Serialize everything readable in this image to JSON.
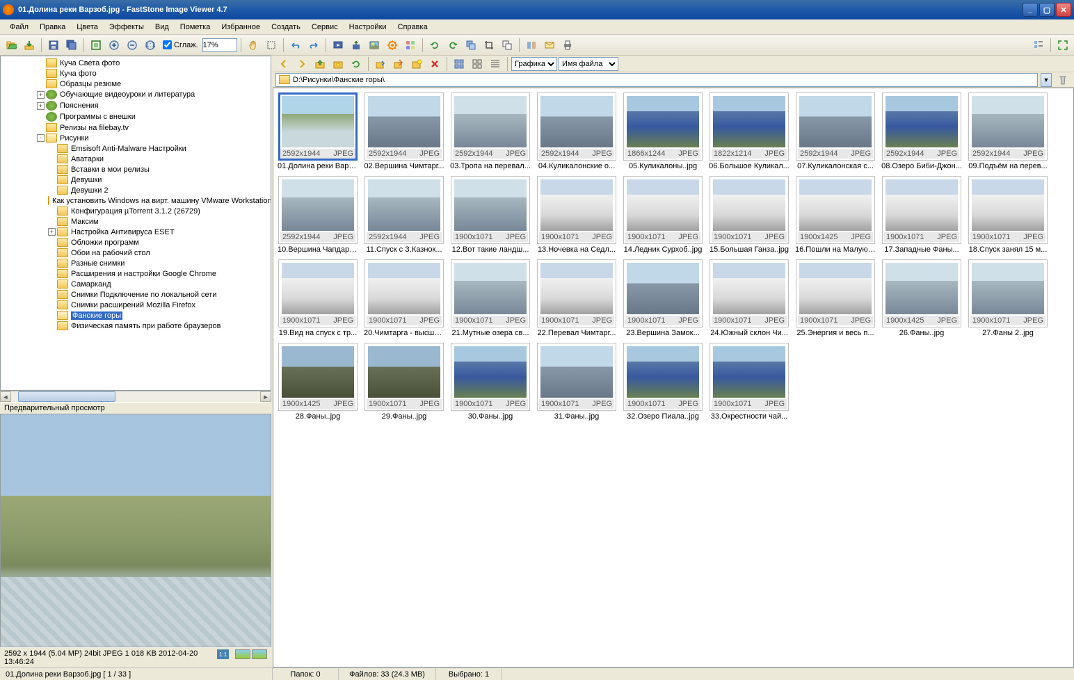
{
  "window": {
    "title": "01.Долина реки Варзоб.jpg  -  FastStone Image Viewer 4.7"
  },
  "menu": [
    "Файл",
    "Правка",
    "Цвета",
    "Эффекты",
    "Вид",
    "Пометка",
    "Избранное",
    "Создать",
    "Сервис",
    "Настройки",
    "Справка"
  ],
  "toolbar": {
    "smooth_label": "Сглаж.",
    "zoom": "17%"
  },
  "tree": [
    {
      "ind": 2,
      "exp": "",
      "ico": "fld",
      "label": "Куча Света фото"
    },
    {
      "ind": 2,
      "exp": "",
      "ico": "fld",
      "label": "Куча фото"
    },
    {
      "ind": 2,
      "exp": "",
      "ico": "fld",
      "label": "Образцы резюме"
    },
    {
      "ind": 2,
      "exp": "+",
      "ico": "gico",
      "label": "Обучающие видеоуроки и литература"
    },
    {
      "ind": 2,
      "exp": "+",
      "ico": "gico",
      "label": "Пояснения"
    },
    {
      "ind": 2,
      "exp": "",
      "ico": "gico",
      "label": "Программы с внешки"
    },
    {
      "ind": 2,
      "exp": "",
      "ico": "fld",
      "label": "Релизы на filebay.tv"
    },
    {
      "ind": 2,
      "exp": "-",
      "ico": "fld-open",
      "label": "Рисунки"
    },
    {
      "ind": 3,
      "exp": "",
      "ico": "fld",
      "label": "Emsisoft Anti-Malware Настройки"
    },
    {
      "ind": 3,
      "exp": "",
      "ico": "fld",
      "label": "Аватарки"
    },
    {
      "ind": 3,
      "exp": "",
      "ico": "fld",
      "label": "Вставки в мои релизы"
    },
    {
      "ind": 3,
      "exp": "",
      "ico": "fld",
      "label": "Девушки"
    },
    {
      "ind": 3,
      "exp": "",
      "ico": "fld",
      "label": "Девушки 2"
    },
    {
      "ind": 3,
      "exp": "",
      "ico": "fld",
      "label": "Как установить Windows на вирт. машину VMware Workstation"
    },
    {
      "ind": 3,
      "exp": "",
      "ico": "fld",
      "label": "Конфигурация  µTorrent 3.1.2 (26729)"
    },
    {
      "ind": 3,
      "exp": "",
      "ico": "fld",
      "label": "Максим"
    },
    {
      "ind": 3,
      "exp": "+",
      "ico": "fld",
      "label": "Настройка Антивируса ESET"
    },
    {
      "ind": 3,
      "exp": "",
      "ico": "fld",
      "label": "Обложки программ"
    },
    {
      "ind": 3,
      "exp": "",
      "ico": "fld",
      "label": "Обои на рабочий стол"
    },
    {
      "ind": 3,
      "exp": "",
      "ico": "fld",
      "label": "Разные снимки"
    },
    {
      "ind": 3,
      "exp": "",
      "ico": "fld",
      "label": "Расширения и настройки Google Chrome"
    },
    {
      "ind": 3,
      "exp": "",
      "ico": "fld",
      "label": "Самарканд"
    },
    {
      "ind": 3,
      "exp": "",
      "ico": "fld",
      "label": "Снимки Подключение по локальной сети"
    },
    {
      "ind": 3,
      "exp": "",
      "ico": "fld",
      "label": "Снимки расширений Mozilla Firefox"
    },
    {
      "ind": 3,
      "exp": "",
      "ico": "fld-open",
      "label": "Фанские горы",
      "sel": true
    },
    {
      "ind": 3,
      "exp": "",
      "ico": "fld",
      "label": "Физическая память при работе браузеров"
    }
  ],
  "preview": {
    "label": "Предварительный просмотр",
    "info": "2592 x 1944 (5.04 MP)  24bit  JPEG   1 018 KB   2012-04-20 13:46:24",
    "scale": "1:1"
  },
  "right": {
    "sort1": "Графика",
    "sort2": "Имя файла",
    "path": "D:\\Рисунки\\Фанские горы\\"
  },
  "thumbs": [
    {
      "name": "01.Долина реки Варз...",
      "dim": "2592x1944",
      "fmt": "JPEG",
      "bg": "bg-a",
      "sel": true
    },
    {
      "name": "02.Вершина Чимтарг...",
      "dim": "2592x1944",
      "fmt": "JPEG",
      "bg": "bg-b"
    },
    {
      "name": "03.Тропа на перевал...",
      "dim": "2592x1944",
      "fmt": "JPEG",
      "bg": "bg-d"
    },
    {
      "name": "04.Куликалонские о...",
      "dim": "2592x1944",
      "fmt": "JPEG",
      "bg": "bg-b"
    },
    {
      "name": "05.Куликалоны..jpg",
      "dim": "1866x1244",
      "fmt": "JPEG",
      "bg": "bg-c"
    },
    {
      "name": "06.Большое Куликал...",
      "dim": "1822x1214",
      "fmt": "JPEG",
      "bg": "bg-c"
    },
    {
      "name": "07.Куликалонская с...",
      "dim": "2592x1944",
      "fmt": "JPEG",
      "bg": "bg-b"
    },
    {
      "name": "08.Озеро Биби-Джон...",
      "dim": "2592x1944",
      "fmt": "JPEG",
      "bg": "bg-c"
    },
    {
      "name": "09.Подъём на перев...",
      "dim": "2592x1944",
      "fmt": "JPEG",
      "bg": "bg-d"
    },
    {
      "name": "10.Вершина Чапдара...",
      "dim": "2592x1944",
      "fmt": "JPEG",
      "bg": "bg-d"
    },
    {
      "name": "11.Спуск с З.Казнок...",
      "dim": "2592x1944",
      "fmt": "JPEG",
      "bg": "bg-d"
    },
    {
      "name": "12.Вот такие ландш...",
      "dim": "1900x1071",
      "fmt": "JPEG",
      "bg": "bg-d"
    },
    {
      "name": "13.Ночевка на Седл...",
      "dim": "1900x1071",
      "fmt": "JPEG",
      "bg": "bg-e"
    },
    {
      "name": "14.Ледник Сурхоб..jpg",
      "dim": "1900x1071",
      "fmt": "JPEG",
      "bg": "bg-e"
    },
    {
      "name": "15.Большая Ганза..jpg",
      "dim": "1900x1071",
      "fmt": "JPEG",
      "bg": "bg-e"
    },
    {
      "name": "16.Пошли на Малую ...",
      "dim": "1900x1425",
      "fmt": "JPEG",
      "bg": "bg-e"
    },
    {
      "name": "17.Западные Фаны...",
      "dim": "1900x1071",
      "fmt": "JPEG",
      "bg": "bg-e"
    },
    {
      "name": "18.Спуск занял 15 м...",
      "dim": "1900x1071",
      "fmt": "JPEG",
      "bg": "bg-e"
    },
    {
      "name": "19.Вид на спуск с тр...",
      "dim": "1900x1071",
      "fmt": "JPEG",
      "bg": "bg-e"
    },
    {
      "name": "20.Чимтарга - высша...",
      "dim": "1900x1071",
      "fmt": "JPEG",
      "bg": "bg-e"
    },
    {
      "name": "21.Мутные озера св...",
      "dim": "1900x1071",
      "fmt": "JPEG",
      "bg": "bg-d"
    },
    {
      "name": "22.Перевал Чимтарг...",
      "dim": "1900x1071",
      "fmt": "JPEG",
      "bg": "bg-e"
    },
    {
      "name": "23.Вершина Замок...",
      "dim": "1900x1071",
      "fmt": "JPEG",
      "bg": "bg-b"
    },
    {
      "name": "24.Южный склон Чи...",
      "dim": "1900x1071",
      "fmt": "JPEG",
      "bg": "bg-e"
    },
    {
      "name": "25.Энергия и весь п...",
      "dim": "1900x1071",
      "fmt": "JPEG",
      "bg": "bg-e"
    },
    {
      "name": "26.Фаны..jpg",
      "dim": "1900x1425",
      "fmt": "JPEG",
      "bg": "bg-d"
    },
    {
      "name": "27.Фаны 2..jpg",
      "dim": "1900x1071",
      "fmt": "JPEG",
      "bg": "bg-d"
    },
    {
      "name": "28.Фаны..jpg",
      "dim": "1900x1425",
      "fmt": "JPEG",
      "bg": "bg-f"
    },
    {
      "name": "29.Фаны..jpg",
      "dim": "1900x1071",
      "fmt": "JPEG",
      "bg": "bg-f"
    },
    {
      "name": "30.Фаны..jpg",
      "dim": "1900x1071",
      "fmt": "JPEG",
      "bg": "bg-c"
    },
    {
      "name": "31.Фаны..jpg",
      "dim": "1900x1071",
      "fmt": "JPEG",
      "bg": "bg-b"
    },
    {
      "name": "32.Озеро Пиала..jpg",
      "dim": "1900x1071",
      "fmt": "JPEG",
      "bg": "bg-c"
    },
    {
      "name": "33.Окрестности чай...",
      "dim": "1900x1071",
      "fmt": "JPEG",
      "bg": "bg-c"
    }
  ],
  "status": {
    "file": "01.Долина реки Варзоб.jpg [ 1 / 33 ]",
    "folders": "Папок: 0",
    "files": "Файлов: 33 (24.3 MB)",
    "selected": "Выбрано: 1"
  }
}
